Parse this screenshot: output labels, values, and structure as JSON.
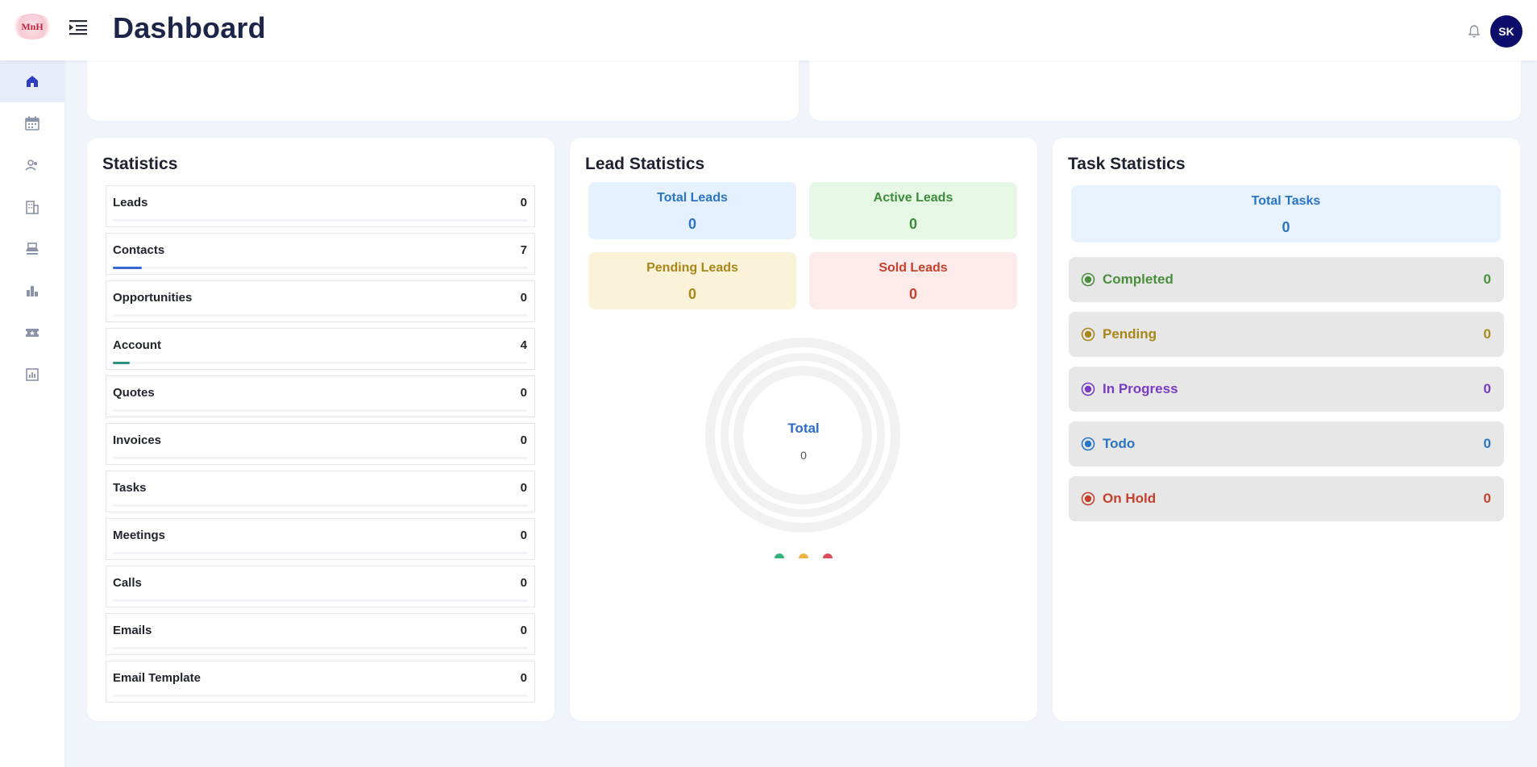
{
  "header": {
    "logo_text": "MnH",
    "title": "Dashboard",
    "avatar_initials": "SK"
  },
  "sidebar": {
    "items": [
      {
        "icon": "home-icon",
        "active": true
      },
      {
        "icon": "calendar-icon",
        "active": false
      },
      {
        "icon": "users-icon",
        "active": false
      },
      {
        "icon": "building-icon",
        "active": false
      },
      {
        "icon": "desk-icon",
        "active": false
      },
      {
        "icon": "bar-chart-icon",
        "active": false
      },
      {
        "icon": "ticket-icon",
        "active": false
      },
      {
        "icon": "report-icon",
        "active": false
      }
    ]
  },
  "statistics": {
    "title": "Statistics",
    "rows": [
      {
        "label": "Leads",
        "value": "0"
      },
      {
        "label": "Contacts",
        "value": "7",
        "progress": 0.07,
        "color": "#3a66d6"
      },
      {
        "label": "Opportunities",
        "value": "0"
      },
      {
        "label": "Account",
        "value": "4",
        "progress": 0.04,
        "color": "#2e8f7a"
      },
      {
        "label": "Quotes",
        "value": "0"
      },
      {
        "label": "Invoices",
        "value": "0"
      },
      {
        "label": "Tasks",
        "value": "0"
      },
      {
        "label": "Meetings",
        "value": "0"
      },
      {
        "label": "Calls",
        "value": "0"
      },
      {
        "label": "Emails",
        "value": "0"
      },
      {
        "label": "Email Template",
        "value": "0"
      }
    ]
  },
  "lead_statistics": {
    "title": "Lead Statistics",
    "tiles": [
      {
        "label": "Total Leads",
        "value": "0",
        "bg": "#e6f1ff",
        "color": "#2a74c4"
      },
      {
        "label": "Active Leads",
        "value": "0",
        "bg": "#e6f7e6",
        "color": "#3d8b38"
      },
      {
        "label": "Pending Leads",
        "value": "0",
        "bg": "#faf2d9",
        "color": "#a8861a"
      },
      {
        "label": "Sold Leads",
        "value": "0",
        "bg": "#fdeaea",
        "color": "#c4412e"
      }
    ],
    "donut_total_label": "Total",
    "donut_total_value": "0",
    "legend_colors": [
      "#2fb37a",
      "#f0b341",
      "#e04d5a"
    ]
  },
  "task_statistics": {
    "title": "Task Statistics",
    "total_label": "Total Tasks",
    "total_value": "0",
    "rows": [
      {
        "label": "Completed",
        "value": "0",
        "color": "#4a8f3c"
      },
      {
        "label": "Pending",
        "value": "0",
        "color": "#a8861a"
      },
      {
        "label": "In Progress",
        "value": "0",
        "color": "#7a3bc4"
      },
      {
        "label": "Todo",
        "value": "0",
        "color": "#2a74c4"
      },
      {
        "label": "On Hold",
        "value": "0",
        "color": "#c4412e"
      }
    ]
  }
}
